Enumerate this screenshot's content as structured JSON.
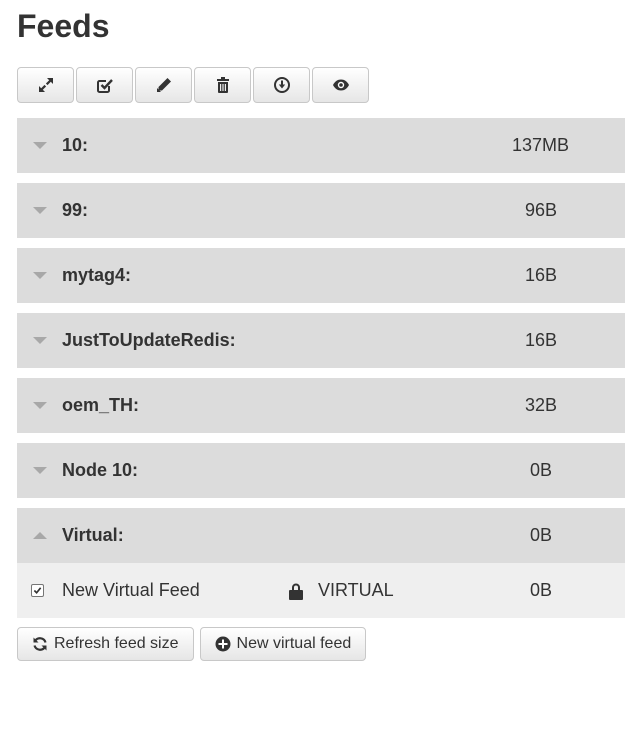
{
  "page": {
    "title": "Feeds"
  },
  "toolbar": {
    "buttons": [
      {
        "icon": "expand-icon"
      },
      {
        "icon": "select-all-icon"
      },
      {
        "icon": "edit-icon"
      },
      {
        "icon": "trash-icon"
      },
      {
        "icon": "download-icon"
      },
      {
        "icon": "eye-icon"
      }
    ]
  },
  "groups": [
    {
      "name": "10:",
      "size": "137MB",
      "expanded": false
    },
    {
      "name": "99:",
      "size": "96B",
      "expanded": false
    },
    {
      "name": "mytag4:",
      "size": "16B",
      "expanded": false
    },
    {
      "name": "JustToUpdateRedis:",
      "size": "16B",
      "expanded": false
    },
    {
      "name": "oem_TH:",
      "size": "32B",
      "expanded": false
    },
    {
      "name": "Node 10:",
      "size": "0B",
      "expanded": false
    },
    {
      "name": "Virtual:",
      "size": "0B",
      "expanded": true
    }
  ],
  "feeds": [
    {
      "name": "New Virtual Feed",
      "engine": "VIRTUAL",
      "size": "0B",
      "checked": true
    }
  ],
  "actions": {
    "refresh_label": "Refresh feed size",
    "new_virtual_label": "New virtual feed"
  }
}
